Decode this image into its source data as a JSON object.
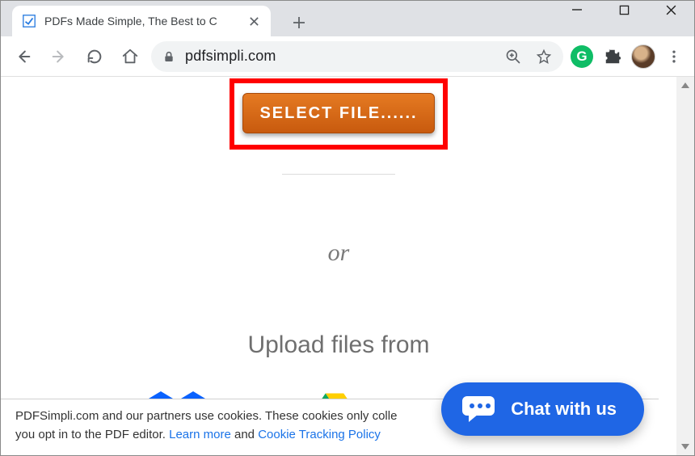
{
  "window": {
    "tab_title": "PDFs Made Simple, The Best to C"
  },
  "toolbar": {
    "url": "pdfsimpli.com",
    "grammarly_initial": "G"
  },
  "page": {
    "select_file_label": "SELECT FILE......",
    "or_label": "or",
    "upload_from_label": "Upload files from"
  },
  "cookie": {
    "text_prefix": "PDFSimpli.com and our partners use cookies. These cookies only colle",
    "text_line2_prefix": "you opt in to the PDF editor. ",
    "learn_more": "Learn more",
    "and_word": " and ",
    "policy": "Cookie Tracking Policy"
  },
  "chat": {
    "label": "Chat with us"
  }
}
